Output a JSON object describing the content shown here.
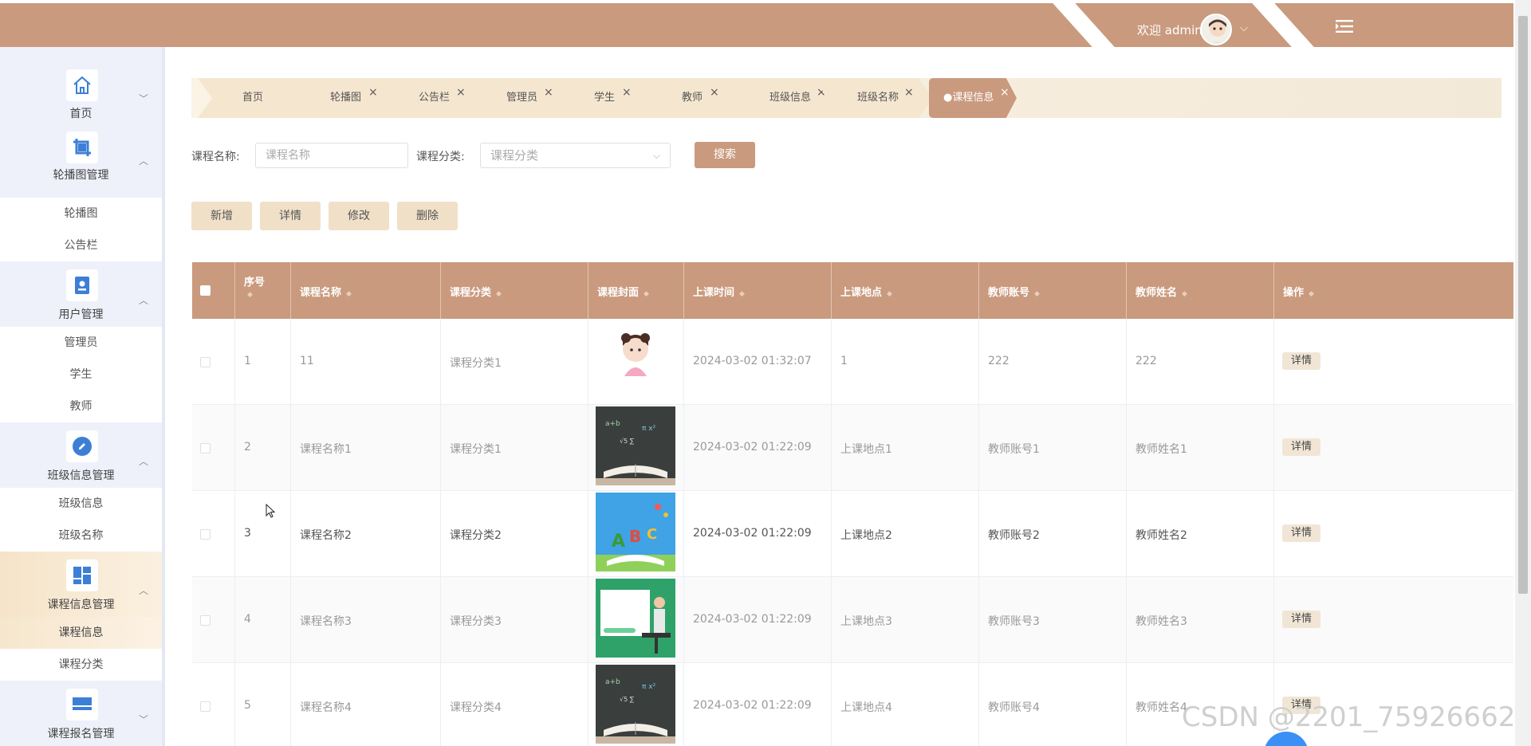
{
  "header": {
    "welcome": "欢迎 admin"
  },
  "sidebar": {
    "home": "首页",
    "carousel_mgmt": "轮播图管理",
    "carousel": "轮播图",
    "notice": "公告栏",
    "user_mgmt": "用户管理",
    "admin": "管理员",
    "student": "学生",
    "teacher": "教师",
    "class_mgmt": "班级信息管理",
    "class_info": "班级信息",
    "class_name": "班级名称",
    "course_mgmt": "课程信息管理",
    "course_info": "课程信息",
    "course_category": "课程分类",
    "enroll_mgmt": "课程报名管理"
  },
  "tabs": [
    {
      "label": "首页"
    },
    {
      "label": "轮播图"
    },
    {
      "label": "公告栏"
    },
    {
      "label": "管理员"
    },
    {
      "label": "学生"
    },
    {
      "label": "教师"
    },
    {
      "label": "班级信息"
    },
    {
      "label": "班级名称"
    },
    {
      "label": "●课程信息"
    }
  ],
  "search": {
    "name_label": "课程名称:",
    "name_placeholder": "课程名称",
    "category_label": "课程分类:",
    "category_placeholder": "课程分类",
    "search_btn": "搜索"
  },
  "actions": {
    "add": "新增",
    "detail": "详情",
    "edit": "修改",
    "delete": "删除"
  },
  "table": {
    "headers": [
      "序号",
      "课程名称",
      "课程分类",
      "课程封面",
      "上课时间",
      "上课地点",
      "教师账号",
      "教师姓名",
      "操作"
    ],
    "detail_label": "详情",
    "rows": [
      {
        "no": "1",
        "name": "11",
        "category": "课程分类1",
        "time": "2024-03-02 01:32:07",
        "place": "1",
        "account": "222",
        "teacher": "222"
      },
      {
        "no": "2",
        "name": "课程名称1",
        "category": "课程分类1",
        "time": "2024-03-02 01:22:09",
        "place": "上课地点1",
        "account": "教师账号1",
        "teacher": "教师姓名1"
      },
      {
        "no": "3",
        "name": "课程名称2",
        "category": "课程分类2",
        "time": "2024-03-02 01:22:09",
        "place": "上课地点2",
        "account": "教师账号2",
        "teacher": "教师姓名2"
      },
      {
        "no": "4",
        "name": "课程名称3",
        "category": "课程分类3",
        "time": "2024-03-02 01:22:09",
        "place": "上课地点3",
        "account": "教师账号3",
        "teacher": "教师姓名3"
      },
      {
        "no": "5",
        "name": "课程名称4",
        "category": "课程分类4",
        "time": "2024-03-02 01:22:09",
        "place": "上课地点4",
        "account": "教师账号4",
        "teacher": "教师姓名4"
      }
    ]
  },
  "watermark": "CSDN @2201_75926662",
  "colors": {
    "accent": "#c99a7e",
    "tab_bg": "#f5e7cf",
    "sidebar_bg": "#eef1fa",
    "icon_blue": "#3d7fd6"
  }
}
